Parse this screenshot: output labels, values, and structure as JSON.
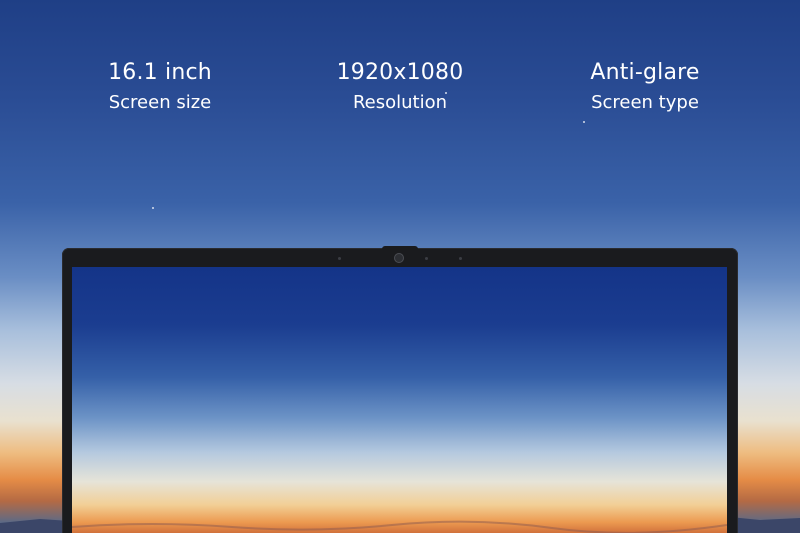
{
  "specs": [
    {
      "value": "16.1 inch",
      "label": "Screen size"
    },
    {
      "value": "1920x1080",
      "label": "Resolution"
    },
    {
      "value": "Anti-glare",
      "label": "Screen type"
    }
  ],
  "colors": {
    "sky_top": "#1f3f86",
    "horizon_glow": "#e58c46",
    "bezel": "#1a1b1e",
    "text": "#ffffff"
  },
  "icons": [
    "webcam-icon",
    "microphone-icon"
  ]
}
